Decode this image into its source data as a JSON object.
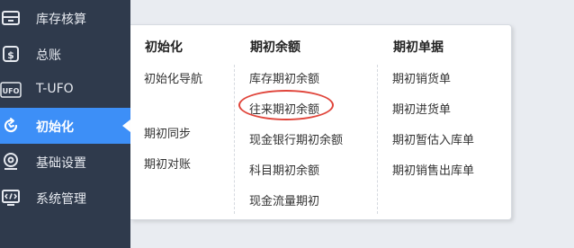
{
  "sidebar": {
    "items": [
      {
        "label": "库存核算",
        "icon": "stock-accounting-icon"
      },
      {
        "label": "总账",
        "icon": "ledger-icon"
      },
      {
        "label": "T-UFO",
        "icon": "ufo-report-icon"
      },
      {
        "label": "初始化",
        "icon": "initialize-icon",
        "active": true
      },
      {
        "label": "基础设置",
        "icon": "basic-settings-icon"
      },
      {
        "label": "系统管理",
        "icon": "system-management-icon"
      }
    ],
    "active_color": "#3d8ff7",
    "background_color": "#2f3a4c"
  },
  "menu": {
    "columns": [
      {
        "title": "初始化",
        "items": [
          "初始化导航",
          "期初同步",
          "期初对账"
        ]
      },
      {
        "title": "期初余额",
        "items": [
          "库存期初余额",
          "往来期初余额",
          "现金银行期初余额",
          "科目期初余额",
          "现金流量期初"
        ]
      },
      {
        "title": "期初单据",
        "items": [
          "期初销货单",
          "期初进货单",
          "期初暂估入库单",
          "期初销售出库单"
        ]
      }
    ],
    "highlighted_item": "往来期初余额",
    "highlight_color": "#e0453b"
  }
}
